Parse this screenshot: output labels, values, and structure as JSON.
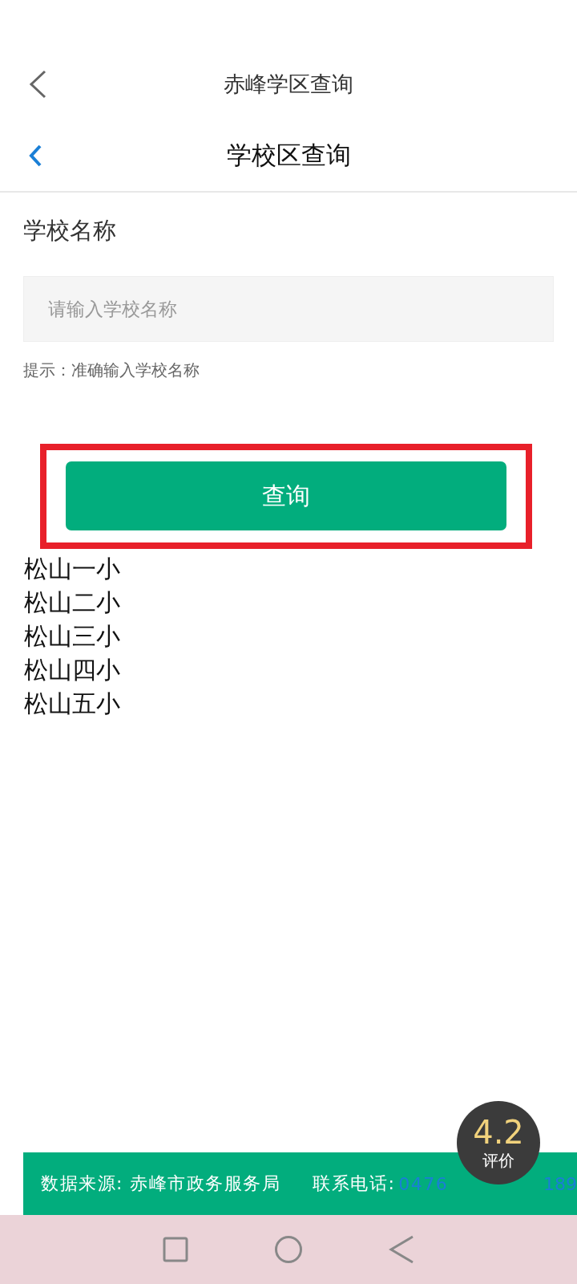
{
  "outer_header": {
    "title": "赤峰学区查询"
  },
  "inner_header": {
    "title": "学校区查询"
  },
  "form": {
    "label": "学校名称",
    "placeholder": "请输入学校名称",
    "hint": "提示：准确输入学校名称",
    "button": "查询",
    "highlighted": true
  },
  "results": [
    "松山一小",
    "松山二小",
    "松山三小",
    "松山四小",
    "松山五小"
  ],
  "footer": {
    "source": "数据来源: 赤峰市政务服务局",
    "phone_label": "联系电话:",
    "phone_start": "0476",
    "phone_end": "189"
  },
  "rating": {
    "score": "4.2",
    "label": "评价"
  }
}
